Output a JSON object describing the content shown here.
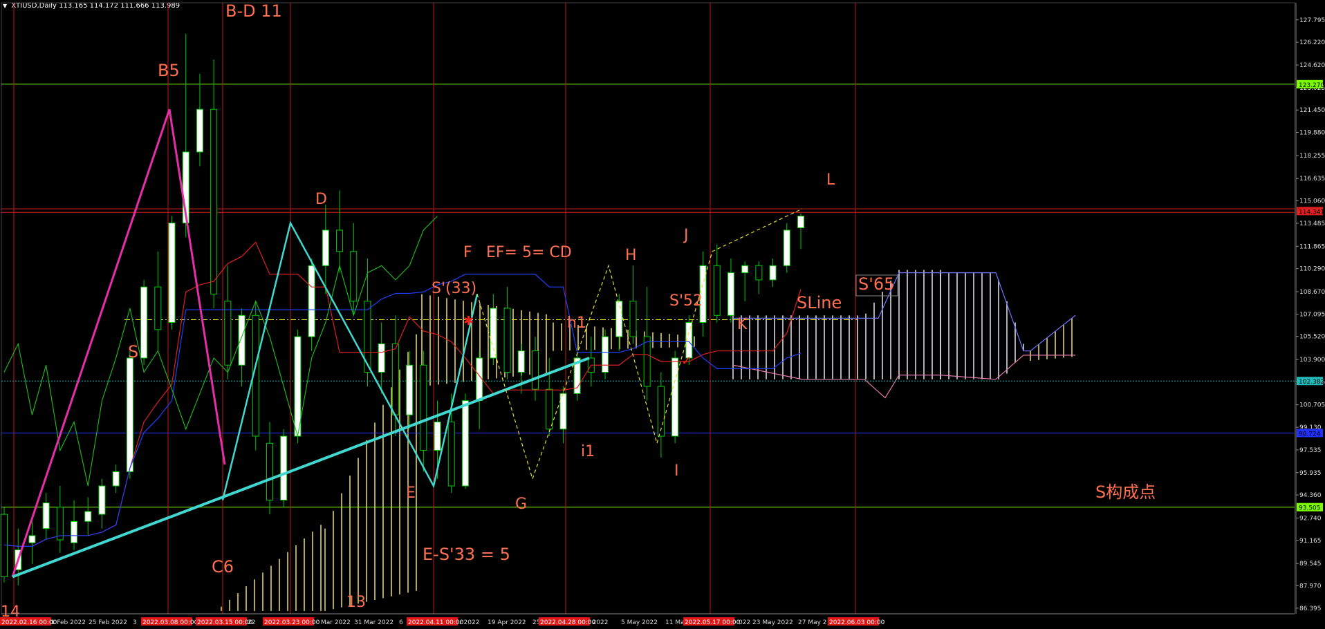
{
  "header": {
    "symbol": "XTIUSD,Daily",
    "ohlc": "113.165 114.172 111.666 113.989"
  },
  "colors": {
    "background": "#000000",
    "bull_candle": "#00cc00",
    "bull_fill": "#ffffff",
    "bear_candle": "#00cc00",
    "cloud_bull": "#f0e060",
    "cloud_bear": "#e6e6ee",
    "tenkan": "#e02020",
    "kijun": "#2040ff",
    "chikou": "#20c020",
    "annotation": "#ff7050",
    "zigzag": "#e62ea8",
    "trendline": "#40d8d0",
    "vline": "#c01818"
  },
  "chart_data": {
    "type": "candlestick",
    "title": "XTIUSD,Daily",
    "ylim": [
      86.0,
      129.0
    ],
    "y_ticks": [
      "127.795",
      "126.220",
      "124.620",
      "123.025",
      "121.450",
      "119.880",
      "118.255",
      "116.635",
      "115.060",
      "113.485",
      "111.865",
      "110.290",
      "108.670",
      "107.095",
      "105.520",
      "103.900",
      "102.325",
      "100.705",
      "99.130",
      "97.535",
      "95.935",
      "94.360",
      "92.740",
      "91.165",
      "89.545",
      "87.970",
      "86.395"
    ],
    "x_ticks": [
      "21 Feb 2022",
      "25 Feb 2022",
      "3",
      "22",
      "Mar 2022",
      "31 Mar 2022",
      "6",
      "r 2022",
      "19 Apr 2022",
      "25",
      "r 2022",
      "5 May 2022",
      "11 Ma",
      "022",
      "23 May 2022",
      "27 May 2"
    ],
    "vline_stamps": [
      "2022.02.16 00:00",
      "2022.03.08 00:00",
      "2022.03.15 00:00",
      "2022.03.23 00:00",
      "2022.04.11 00:00",
      "2022.04.28 00:00",
      "2022.05.17 00:00",
      "2022.06.03 00:00"
    ],
    "price_tags": [
      {
        "value": "123.270",
        "color": "#7cfc00"
      },
      {
        "value": "114.341",
        "color": "#e02020"
      },
      {
        "value": "102.382",
        "color": "#22bbbb"
      },
      {
        "value": "98.724",
        "color": "#2030ff"
      },
      {
        "value": "93.505",
        "color": "#7cfc00"
      }
    ],
    "h_levels": [
      123.27,
      114.5,
      114.25,
      102.382,
      98.724,
      93.505,
      106.7
    ],
    "candles": [
      {
        "o": 93.0,
        "h": 93.5,
        "l": 88.2,
        "c": 88.6
      },
      {
        "o": 89.1,
        "h": 92.0,
        "l": 88.0,
        "c": 90.5
      },
      {
        "o": 91.0,
        "h": 92.5,
        "l": 89.5,
        "c": 91.5
      },
      {
        "o": 92.0,
        "h": 94.5,
        "l": 91.2,
        "c": 93.8
      },
      {
        "o": 93.5,
        "h": 95.0,
        "l": 90.3,
        "c": 91.2
      },
      {
        "o": 91.0,
        "h": 94.0,
        "l": 90.5,
        "c": 92.5
      },
      {
        "o": 92.5,
        "h": 94.2,
        "l": 91.5,
        "c": 93.2
      },
      {
        "o": 93.0,
        "h": 95.5,
        "l": 92.0,
        "c": 95.0
      },
      {
        "o": 95.0,
        "h": 96.5,
        "l": 94.5,
        "c": 96.0
      },
      {
        "o": 96.0,
        "h": 104.5,
        "l": 95.5,
        "c": 104.0
      },
      {
        "o": 104.0,
        "h": 109.5,
        "l": 103.5,
        "c": 109.0
      },
      {
        "o": 109.0,
        "h": 111.5,
        "l": 104.5,
        "c": 106.0
      },
      {
        "o": 106.5,
        "h": 114.0,
        "l": 106.0,
        "c": 113.5
      },
      {
        "o": 113.5,
        "h": 126.8,
        "l": 112.5,
        "c": 118.5
      },
      {
        "o": 118.5,
        "h": 124.0,
        "l": 117.5,
        "c": 121.5
      },
      {
        "o": 121.5,
        "h": 125.0,
        "l": 107.5,
        "c": 108.5
      },
      {
        "o": 108.0,
        "h": 110.5,
        "l": 102.5,
        "c": 103.5
      },
      {
        "o": 103.5,
        "h": 107.5,
        "l": 102.0,
        "c": 107.0
      },
      {
        "o": 107.0,
        "h": 108.0,
        "l": 97.5,
        "c": 98.5
      },
      {
        "o": 98.0,
        "h": 99.5,
        "l": 93.0,
        "c": 94.0
      },
      {
        "o": 94.0,
        "h": 99.0,
        "l": 93.5,
        "c": 98.5
      },
      {
        "o": 98.5,
        "h": 106.0,
        "l": 98.0,
        "c": 105.5
      },
      {
        "o": 105.5,
        "h": 111.0,
        "l": 104.5,
        "c": 110.5
      },
      {
        "o": 110.5,
        "h": 114.8,
        "l": 108.5,
        "c": 113.0
      },
      {
        "o": 113.0,
        "h": 115.8,
        "l": 110.0,
        "c": 111.5
      },
      {
        "o": 111.5,
        "h": 113.5,
        "l": 107.0,
        "c": 108.0
      },
      {
        "o": 108.0,
        "h": 111.0,
        "l": 102.0,
        "c": 103.0
      },
      {
        "o": 103.0,
        "h": 106.5,
        "l": 101.5,
        "c": 105.0
      },
      {
        "o": 105.0,
        "h": 107.0,
        "l": 98.5,
        "c": 100.0
      },
      {
        "o": 100.0,
        "h": 104.5,
        "l": 99.0,
        "c": 103.5
      },
      {
        "o": 103.5,
        "h": 104.5,
        "l": 96.0,
        "c": 97.5
      },
      {
        "o": 97.5,
        "h": 101.0,
        "l": 95.5,
        "c": 99.5
      },
      {
        "o": 99.5,
        "h": 101.5,
        "l": 94.5,
        "c": 95.0
      },
      {
        "o": 95.0,
        "h": 101.5,
        "l": 94.8,
        "c": 101.0
      },
      {
        "o": 101.0,
        "h": 104.5,
        "l": 99.0,
        "c": 104.0
      },
      {
        "o": 104.0,
        "h": 108.5,
        "l": 103.5,
        "c": 107.5
      },
      {
        "o": 107.5,
        "h": 109.0,
        "l": 102.5,
        "c": 103.0
      },
      {
        "o": 103.0,
        "h": 105.0,
        "l": 101.5,
        "c": 104.5
      },
      {
        "o": 104.5,
        "h": 105.5,
        "l": 101.0,
        "c": 101.8
      },
      {
        "o": 101.8,
        "h": 104.0,
        "l": 98.5,
        "c": 99.0
      },
      {
        "o": 99.0,
        "h": 102.0,
        "l": 98.0,
        "c": 101.5
      },
      {
        "o": 101.5,
        "h": 104.5,
        "l": 101.0,
        "c": 104.0
      },
      {
        "o": 104.0,
        "h": 105.5,
        "l": 102.0,
        "c": 103.0
      },
      {
        "o": 103.0,
        "h": 106.0,
        "l": 102.5,
        "c": 105.5
      },
      {
        "o": 105.5,
        "h": 108.5,
        "l": 104.5,
        "c": 108.0
      },
      {
        "o": 108.0,
        "h": 110.5,
        "l": 105.0,
        "c": 105.5
      },
      {
        "o": 105.5,
        "h": 109.0,
        "l": 101.0,
        "c": 102.0
      },
      {
        "o": 102.0,
        "h": 103.0,
        "l": 97.0,
        "c": 98.5
      },
      {
        "o": 98.5,
        "h": 104.5,
        "l": 98.0,
        "c": 104.0
      },
      {
        "o": 104.0,
        "h": 107.0,
        "l": 103.5,
        "c": 106.5
      },
      {
        "o": 106.5,
        "h": 111.5,
        "l": 105.5,
        "c": 110.5
      },
      {
        "o": 110.5,
        "h": 112.0,
        "l": 106.5,
        "c": 107.0
      },
      {
        "o": 107.0,
        "h": 111.0,
        "l": 106.5,
        "c": 110.0
      },
      {
        "o": 110.0,
        "h": 110.8,
        "l": 108.0,
        "c": 110.5
      },
      {
        "o": 110.5,
        "h": 110.8,
        "l": 108.5,
        "c": 109.5
      },
      {
        "o": 109.5,
        "h": 111.0,
        "l": 109.0,
        "c": 110.5
      },
      {
        "o": 110.5,
        "h": 113.5,
        "l": 110.0,
        "c": 113.0
      },
      {
        "o": 113.165,
        "h": 114.172,
        "l": 111.666,
        "c": 113.989
      }
    ]
  },
  "annotations": {
    "bd11": "B-D 11",
    "b5": "B5",
    "s": "S",
    "d": "D",
    "f": "F",
    "ef": "EF= 5= CD",
    "s33": "S'(33)",
    "h": "H",
    "h1": "h1",
    "j": "J",
    "l": "L",
    "s52": "S'52",
    "sline": "SLine",
    "s65": "S'65",
    "k": "K",
    "c6": "C6",
    "e": "E",
    "g": "G",
    "i1": "i1",
    "i": "I",
    "es33": "E-S'33 = 5",
    "n13": "13",
    "n14": "14",
    "s_point": "S构成点"
  }
}
